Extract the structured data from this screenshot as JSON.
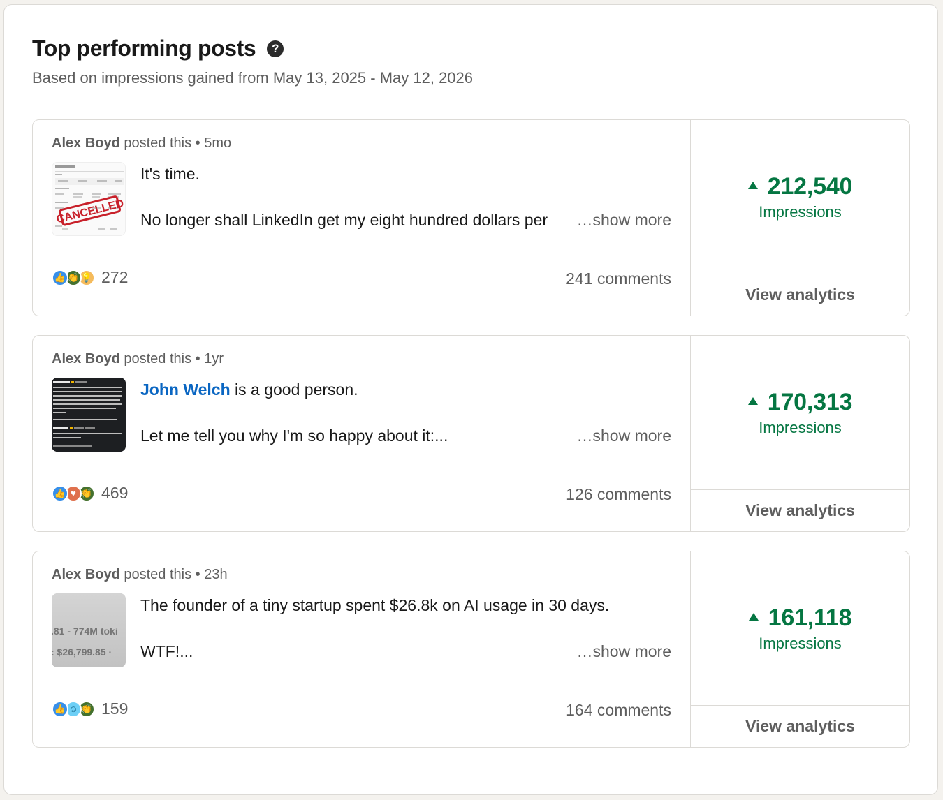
{
  "header": {
    "title": "Top performing posts",
    "help_icon": "help-circle-icon",
    "subtitle": "Based on impressions gained from May 13, 2025 - May 12, 2026"
  },
  "colors": {
    "accent_green": "#057642",
    "link_blue": "#0a66c2",
    "muted_text": "#5e5e5e"
  },
  "posts": [
    {
      "author": "Alex Boyd",
      "posted_text": "posted this",
      "separator": "•",
      "age": "5mo",
      "line1": "It's time.",
      "line2": "No longer shall LinkedIn get my eight hundred dollars per",
      "show_more": "…show more",
      "thumbnail": {
        "stamp_text": "CANCELLED"
      },
      "reaction_icons": [
        "like-icon",
        "celebrate-icon",
        "insightful-icon"
      ],
      "reaction_count": "272",
      "comments": "241 comments",
      "impressions": "212,540",
      "impressions_label": "Impressions",
      "trend_icon": "triangle-up-icon",
      "cta": "View analytics"
    },
    {
      "author": "Alex Boyd",
      "posted_text": "posted this",
      "separator": "•",
      "age": "1yr",
      "mention": "John Welch",
      "line1_rest": " is a good person.",
      "line2": "Let me tell you why I'm so happy about it:...",
      "show_more": "…show more",
      "reaction_icons": [
        "like-icon",
        "love-icon",
        "celebrate-icon"
      ],
      "reaction_count": "469",
      "comments": "126 comments",
      "impressions": "170,313",
      "impressions_label": "Impressions",
      "trend_icon": "triangle-up-icon",
      "cta": "View analytics"
    },
    {
      "author": "Alex Boyd",
      "posted_text": "posted this",
      "separator": "•",
      "age": "23h",
      "line1": "The founder of a tiny startup spent $26.8k on AI usage in 30 days.",
      "line2": "WTF!...",
      "show_more": "…show more",
      "thumbnail": {
        "row1": ".81 - 774M toki",
        "row2": ": $26,799.85 ·"
      },
      "reaction_icons": [
        "like-icon",
        "funny-icon",
        "celebrate-icon"
      ],
      "reaction_count": "159",
      "comments": "164 comments",
      "impressions": "161,118",
      "impressions_label": "Impressions",
      "trend_icon": "triangle-up-icon",
      "cta": "View analytics"
    }
  ]
}
